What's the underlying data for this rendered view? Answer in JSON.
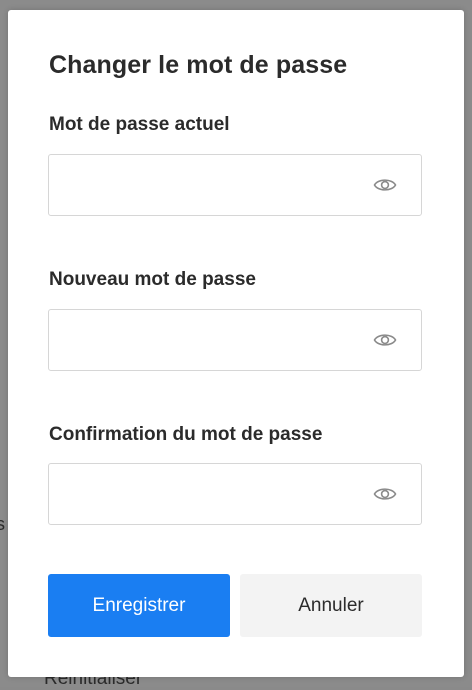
{
  "background": {
    "partial_text_left": "s",
    "partial_text_bottom": "Réinitialiser"
  },
  "dialog": {
    "title": "Changer le mot de passe",
    "fields": [
      {
        "label": "Mot de passe actuel",
        "value": "",
        "placeholder": "",
        "toggle_icon": "eye-icon"
      },
      {
        "label": "Nouveau mot de passe",
        "value": "",
        "placeholder": "",
        "toggle_icon": "eye-icon"
      },
      {
        "label": "Confirmation du mot de passe",
        "value": "",
        "placeholder": "",
        "toggle_icon": "eye-icon"
      }
    ],
    "buttons": {
      "save_label": "Enregistrer",
      "cancel_label": "Annuler"
    }
  },
  "colors": {
    "primary": "#1a7ef2",
    "secondary_bg": "#f3f3f3",
    "text": "#2b2b2b",
    "border": "#d6d6d6",
    "overlay": "#8b8b8b"
  }
}
